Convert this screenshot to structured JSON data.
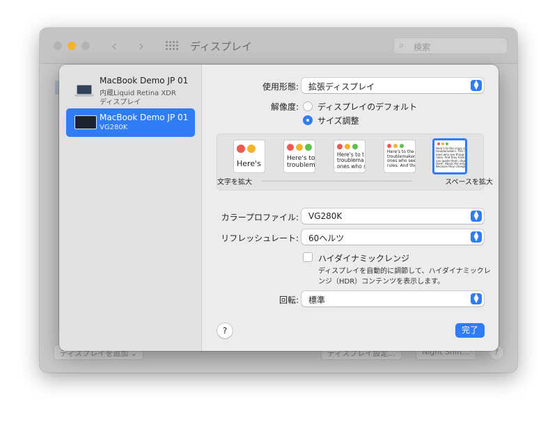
{
  "background_window": {
    "title": "ディスプレイ",
    "search_placeholder": "検索",
    "add_display_label": "ディスプレイを追加",
    "arrange_label": "ディスプレイ設定...",
    "night_shift_label": "Night Shift...",
    "help_label": "?"
  },
  "sidebar": {
    "items": [
      {
        "name": "MacBook Demo JP 01",
        "sub1": "内蔵Liquid Retina XDR",
        "sub2": "ディスプレイ",
        "selected": false
      },
      {
        "name": "MacBook Demo JP 01",
        "sub1": "VG280K",
        "selected": true
      }
    ]
  },
  "main": {
    "use_as_label": "使用形態:",
    "use_as_value": "拡張ディスプレイ",
    "resolution_label": "解像度:",
    "resolution_options": [
      "ディスプレイのデフォルト",
      "サイズ調整"
    ],
    "resolution_selected": "サイズ調整",
    "thumbnails": [
      "Here's",
      "Here's to\ntroublem",
      "Here's to t\ntroublema\nones who s",
      "Here's to the cr\ntroublemakers. T\nones who see th\nrules. And they",
      "Here's to the crazy ones\ntroublemakers. The rou\nones who see things diffe\nrules. And they have no\ncan quote them, disagree\nthem. About the only thi\nBecause they change th"
    ],
    "slider_left_label": "文字を拡大",
    "slider_right_label": "スペースを拡大",
    "color_profile_label": "カラープロファイル:",
    "color_profile_value": "VG280K",
    "refresh_rate_label": "リフレッシュレート:",
    "refresh_rate_value": "60ヘルツ",
    "hdr_label": "ハイダイナミックレンジ",
    "hdr_checked": false,
    "hdr_description": "ディスプレイを自動的に調節して、ハイダイナミックレンジ（HDR）コンテンツを表示します。",
    "rotation_label": "回転:",
    "rotation_value": "標準",
    "help_label": "?",
    "done_label": "完了"
  },
  "colors": {
    "accent": "#2f7cf6",
    "traffic_red": "#ee5a52",
    "traffic_yellow": "#f5b32c",
    "traffic_green": "#5fc04a"
  }
}
